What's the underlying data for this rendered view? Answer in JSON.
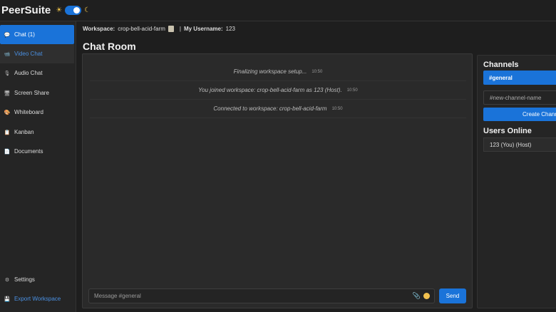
{
  "app": {
    "brand": "PeerSuite",
    "theme_icons": {
      "light": "sun-icon",
      "dark": "moon-icon"
    }
  },
  "sidebar": {
    "items": [
      {
        "label": "Chat (1)",
        "icon": "chat-bubble-icon",
        "state": "active"
      },
      {
        "label": "Video Chat",
        "icon": "video-camera-icon",
        "state": "hover"
      },
      {
        "label": "Audio Chat",
        "icon": "microphone-icon",
        "state": "normal"
      },
      {
        "label": "Screen Share",
        "icon": "monitor-icon",
        "state": "normal"
      },
      {
        "label": "Whiteboard",
        "icon": "palette-icon",
        "state": "normal"
      },
      {
        "label": "Kanban",
        "icon": "clipboard-icon",
        "state": "normal"
      },
      {
        "label": "Documents",
        "icon": "document-icon",
        "state": "normal"
      }
    ],
    "footer": [
      {
        "label": "Settings",
        "icon": "gear-icon"
      },
      {
        "label": "Export Workspace",
        "icon": "export-icon"
      }
    ]
  },
  "workspace_bar": {
    "workspace_label": "Workspace:",
    "workspace_value": "crop-bell-acid-farm",
    "separator": "|",
    "username_label": "My Username:",
    "username_value": "123"
  },
  "chat": {
    "title": "Chat Room",
    "messages": [
      {
        "text": "Finalizing workspace setup...",
        "time": "10:50"
      },
      {
        "text": "You joined workspace: crop-bell-acid-farm as 123 (Host).",
        "time": "10:50"
      },
      {
        "text": "Connected to workspace: crop-bell-acid-farm",
        "time": "10:50"
      }
    ],
    "input_placeholder": "Message #general",
    "send_label": "Send"
  },
  "channels": {
    "heading": "Channels",
    "active_channel": "#general",
    "new_channel_placeholder": "#new-channel-name",
    "create_label": "Create Channel"
  },
  "users": {
    "heading": "Users Online",
    "list": [
      "123 (You) (Host)"
    ]
  },
  "colors": {
    "accent": "#1a73d9",
    "background": "#1e1e1e",
    "panel": "#2a2a2a"
  }
}
